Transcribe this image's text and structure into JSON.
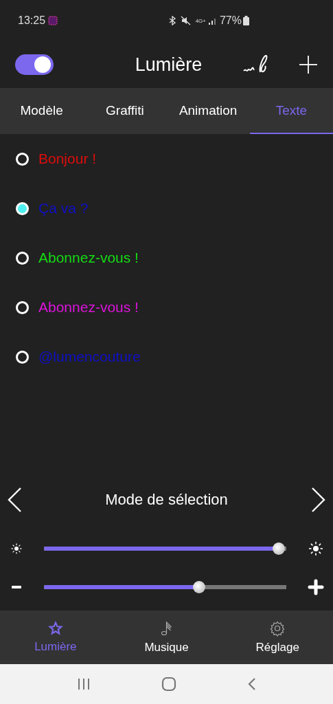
{
  "status_bar": {
    "time": "13:25",
    "network": "4G+",
    "battery": "77%"
  },
  "header": {
    "title": "Lumière",
    "power_on": true
  },
  "tabs": [
    {
      "label": "Modèle",
      "selected": false
    },
    {
      "label": "Graffiti",
      "selected": false
    },
    {
      "label": "Animation",
      "selected": false
    },
    {
      "label": "Texte",
      "selected": true
    }
  ],
  "texts": [
    {
      "label": "Bonjour !",
      "color": "#e00c0c",
      "selected": false
    },
    {
      "label": "Ça va ?",
      "color": "#1010c8",
      "selected": true
    },
    {
      "label": "Abonnez-vous !",
      "color": "#14dc14",
      "selected": false
    },
    {
      "label": "Abonnez-vous !",
      "color": "#dc14dc",
      "selected": false
    },
    {
      "label": "@lumencouture",
      "color": "#1010c8",
      "selected": false
    }
  ],
  "mode": {
    "label": "Mode de sélection"
  },
  "sliders": [
    {
      "kind": "brightness",
      "level": 0.97
    },
    {
      "kind": "size",
      "level": 0.64
    }
  ],
  "bottom_nav": [
    {
      "label": "Lumière",
      "selected": true
    },
    {
      "label": "Musique",
      "selected": false
    },
    {
      "label": "Réglage",
      "selected": false
    }
  ]
}
